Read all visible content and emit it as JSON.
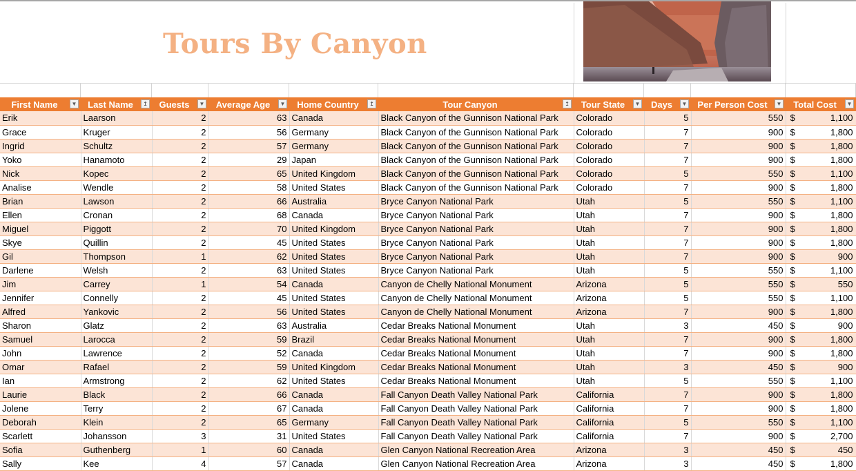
{
  "title": "Tours By Canyon",
  "image": {
    "alt": "canyon-photo"
  },
  "colors": {
    "header_bg": "#ed7d31",
    "band": "#fce4d6",
    "title": "#f4b183"
  },
  "columns": [
    {
      "label": "First Name",
      "filter": "dropdown"
    },
    {
      "label": "Last Name",
      "filter": "sorted-asc"
    },
    {
      "label": "Guests",
      "filter": "dropdown"
    },
    {
      "label": "Average Age",
      "filter": "dropdown"
    },
    {
      "label": "Home Country",
      "filter": "sorted-asc"
    },
    {
      "label": "Tour Canyon",
      "filter": "sorted-asc"
    },
    {
      "label": "Tour State",
      "filter": "dropdown"
    },
    {
      "label": "Days",
      "filter": "dropdown"
    },
    {
      "label": "Per Person Cost",
      "filter": "dropdown"
    },
    {
      "label": "Total Cost",
      "filter": "dropdown"
    }
  ],
  "currency_symbol": "$",
  "rows": [
    [
      "Erik",
      "Laarson",
      "2",
      "63",
      "Canada",
      "Black Canyon of the Gunnison National Park",
      "Colorado",
      "5",
      "550",
      "1,100"
    ],
    [
      "Grace",
      "Kruger",
      "2",
      "56",
      "Germany",
      "Black Canyon of the Gunnison National Park",
      "Colorado",
      "7",
      "900",
      "1,800"
    ],
    [
      "Ingrid",
      "Schultz",
      "2",
      "57",
      "Germany",
      "Black Canyon of the Gunnison National Park",
      "Colorado",
      "7",
      "900",
      "1,800"
    ],
    [
      "Yoko",
      "Hanamoto",
      "2",
      "29",
      "Japan",
      "Black Canyon of the Gunnison National Park",
      "Colorado",
      "7",
      "900",
      "1,800"
    ],
    [
      "Nick",
      "Kopec",
      "2",
      "65",
      "United Kingdom",
      "Black Canyon of the Gunnison National Park",
      "Colorado",
      "5",
      "550",
      "1,100"
    ],
    [
      "Analise",
      "Wendle",
      "2",
      "58",
      "United States",
      "Black Canyon of the Gunnison National Park",
      "Colorado",
      "7",
      "900",
      "1,800"
    ],
    [
      "Brian",
      "Lawson",
      "2",
      "66",
      "Australia",
      "Bryce Canyon National Park",
      "Utah",
      "5",
      "550",
      "1,100"
    ],
    [
      "Ellen",
      "Cronan",
      "2",
      "68",
      "Canada",
      "Bryce Canyon National Park",
      "Utah",
      "7",
      "900",
      "1,800"
    ],
    [
      "Miguel",
      "Piggott",
      "2",
      "70",
      "United Kingdom",
      "Bryce Canyon National Park",
      "Utah",
      "7",
      "900",
      "1,800"
    ],
    [
      "Skye",
      "Quillin",
      "2",
      "45",
      "United States",
      "Bryce Canyon National Park",
      "Utah",
      "7",
      "900",
      "1,800"
    ],
    [
      "Gil",
      "Thompson",
      "1",
      "62",
      "United States",
      "Bryce Canyon National Park",
      "Utah",
      "7",
      "900",
      "900"
    ],
    [
      "Darlene",
      "Welsh",
      "2",
      "63",
      "United States",
      "Bryce Canyon National Park",
      "Utah",
      "5",
      "550",
      "1,100"
    ],
    [
      "Jim",
      "Carrey",
      "1",
      "54",
      "Canada",
      "Canyon de Chelly National Monument",
      "Arizona",
      "5",
      "550",
      "550"
    ],
    [
      "Jennifer",
      "Connelly",
      "2",
      "45",
      "United States",
      "Canyon de Chelly National Monument",
      "Arizona",
      "5",
      "550",
      "1,100"
    ],
    [
      "Alfred",
      "Yankovic",
      "2",
      "56",
      "United States",
      "Canyon de Chelly National Monument",
      "Arizona",
      "7",
      "900",
      "1,800"
    ],
    [
      "Sharon",
      "Glatz",
      "2",
      "63",
      "Australia",
      "Cedar Breaks National Monument",
      "Utah",
      "3",
      "450",
      "900"
    ],
    [
      "Samuel",
      "Larocca",
      "2",
      "59",
      "Brazil",
      "Cedar Breaks National Monument",
      "Utah",
      "7",
      "900",
      "1,800"
    ],
    [
      "John",
      "Lawrence",
      "2",
      "52",
      "Canada",
      "Cedar Breaks National Monument",
      "Utah",
      "7",
      "900",
      "1,800"
    ],
    [
      "Omar",
      "Rafael",
      "2",
      "59",
      "United Kingdom",
      "Cedar Breaks National Monument",
      "Utah",
      "3",
      "450",
      "900"
    ],
    [
      "Ian",
      "Armstrong",
      "2",
      "62",
      "United States",
      "Cedar Breaks National Monument",
      "Utah",
      "5",
      "550",
      "1,100"
    ],
    [
      "Laurie",
      "Black",
      "2",
      "66",
      "Canada",
      "Fall Canyon Death Valley National Park",
      "California",
      "7",
      "900",
      "1,800"
    ],
    [
      "Jolene",
      "Terry",
      "2",
      "67",
      "Canada",
      "Fall Canyon Death Valley National Park",
      "California",
      "7",
      "900",
      "1,800"
    ],
    [
      "Deborah",
      "Klein",
      "2",
      "65",
      "Germany",
      "Fall Canyon Death Valley National Park",
      "California",
      "5",
      "550",
      "1,100"
    ],
    [
      "Scarlett",
      "Johansson",
      "3",
      "31",
      "United States",
      "Fall Canyon Death Valley National Park",
      "California",
      "7",
      "900",
      "2,700"
    ],
    [
      "Sofia",
      "Guthenberg",
      "1",
      "60",
      "Canada",
      "Glen Canyon National Recreation Area",
      "Arizona",
      "3",
      "450",
      "450"
    ],
    [
      "Sally",
      "Kee",
      "4",
      "57",
      "Canada",
      "Glen Canyon National Recreation Area",
      "Arizona",
      "3",
      "450",
      "1,800"
    ]
  ]
}
